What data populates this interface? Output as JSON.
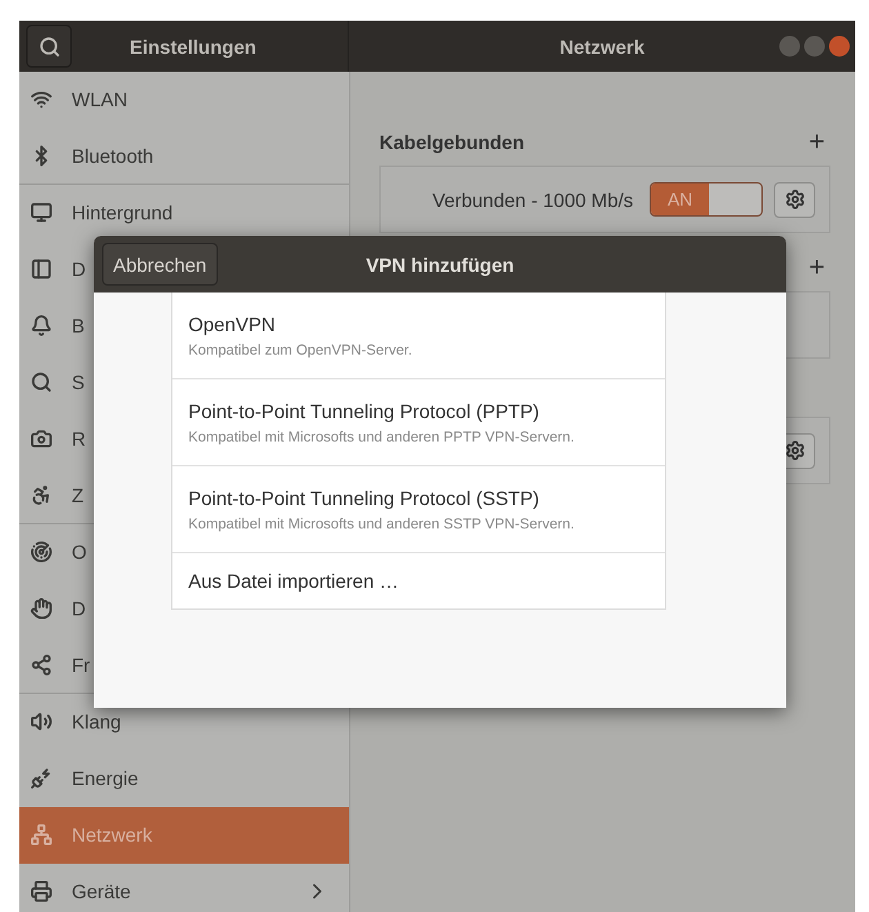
{
  "header": {
    "left_title": "Einstellungen",
    "right_title": "Netzwerk"
  },
  "sidebar": {
    "items": [
      {
        "label": "WLAN",
        "selected": false,
        "divider": false
      },
      {
        "label": "Bluetooth",
        "selected": false,
        "divider": true
      },
      {
        "label": "Hintergrund",
        "selected": false,
        "divider": false
      },
      {
        "label": "D",
        "selected": false,
        "divider": false
      },
      {
        "label": "B",
        "selected": false,
        "divider": false
      },
      {
        "label": "S",
        "selected": false,
        "divider": false
      },
      {
        "label": "R",
        "selected": false,
        "divider": false
      },
      {
        "label": "Z",
        "selected": false,
        "divider": true
      },
      {
        "label": "O",
        "selected": false,
        "divider": false
      },
      {
        "label": "D",
        "selected": false,
        "divider": false
      },
      {
        "label": "Fr",
        "selected": false,
        "divider": true
      },
      {
        "label": "Klang",
        "selected": false,
        "divider": false
      },
      {
        "label": "Energie",
        "selected": false,
        "divider": false
      },
      {
        "label": "Netzwerk",
        "selected": true,
        "divider": false
      },
      {
        "label": "Geräte",
        "selected": false
      }
    ]
  },
  "network": {
    "sections": [
      {
        "title": "Kabelgebunden",
        "add": "+",
        "card": {
          "status": "Verbunden - 1000 Mb/s",
          "switch_label": "AN",
          "on": true,
          "gear": true
        }
      },
      {
        "add": "+",
        "card": {
          "gear": false
        }
      },
      {
        "card": {
          "gear": true
        }
      }
    ]
  },
  "dialog": {
    "cancel": "Abbrechen",
    "title": "VPN hinzufügen",
    "options": [
      {
        "title": "OpenVPN",
        "subtitle": "Kompatibel zum OpenVPN-Server."
      },
      {
        "title": "Point-to-Point Tunneling Protocol (PPTP)",
        "subtitle": "Kompatibel mit Microsofts und anderen PPTP VPN-Servern."
      },
      {
        "title": "Point-to-Point Tunneling Protocol (SSTP)",
        "subtitle": "Kompatibel mit Microsofts und anderen SSTP VPN-Servern."
      },
      {
        "title": "Aus Datei importieren …"
      }
    ]
  }
}
